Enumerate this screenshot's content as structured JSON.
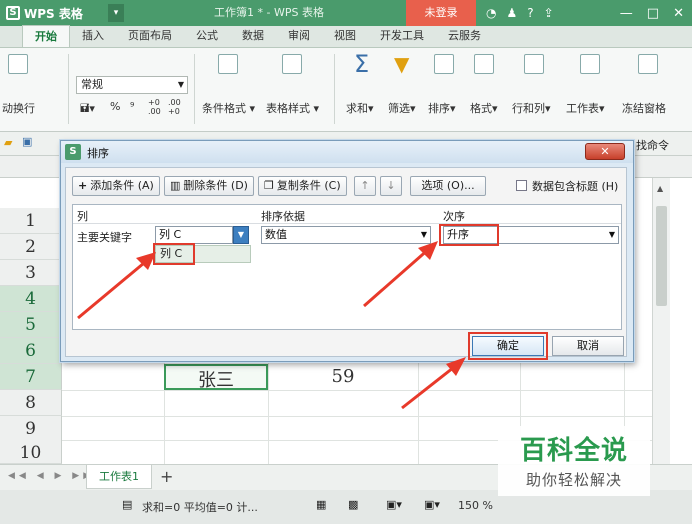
{
  "titlebar": {
    "app_name": "WPS 表格",
    "app_logo_letter": "S",
    "dropdown": "▾",
    "doc_title": "工作簿1 * - WPS 表格",
    "login": "未登录",
    "icons": [
      "skin-icon",
      "shirt-icon",
      "help-icon",
      "upload-icon"
    ],
    "help_label": "?"
  },
  "ribbon": {
    "tabs": [
      "开始",
      "插入",
      "页面布局",
      "公式",
      "数据",
      "审阅",
      "视图",
      "开发工具",
      "云服务"
    ],
    "active_tab": "开始",
    "wrap_label": "动换行",
    "font_name": "常规",
    "percent": "%",
    "comma": "⁹",
    "dec_increase": "+0 .00",
    "dec_decrease": ".00 +0",
    "groups": [
      "条件格式",
      "表格样式",
      "求和",
      "筛选",
      "排序",
      "格式",
      "行和列",
      "工作表",
      "冻结窗格"
    ]
  },
  "quickbar": {
    "find_command": "找命令"
  },
  "sheet": {
    "rows": [
      "1",
      "2",
      "3",
      "4",
      "5",
      "6",
      "7",
      "8",
      "9",
      "10"
    ],
    "highlighted_rows": [
      "4",
      "5",
      "6",
      "7"
    ],
    "cell_name": "张三",
    "cell_score": "59"
  },
  "dialog": {
    "title": "排序",
    "logo": "S",
    "close": "✕",
    "add_condition": "添加条件 (A)",
    "delete_condition": "删除条件 (D)",
    "copy_condition": "复制条件 (C)",
    "move_up": "↑",
    "move_down": "↓",
    "options": "选项 (O)...",
    "has_header": "数据包含标题 (H)",
    "col_header": "列",
    "basis_header": "排序依据",
    "order_header": "次序",
    "primary_key_label": "主要关键字",
    "column_value": "列 C",
    "dropdown_option": "列 C",
    "basis_value": "数值",
    "order_value": "升序",
    "ok": "确定",
    "cancel": "取消"
  },
  "sheet_tabs": {
    "nav": "◀◀ ◀ ▶ ▶▶",
    "tab": "工作表1",
    "add": "+"
  },
  "status": {
    "summary": "求和=0  平均值=0  计...",
    "zoom": "150 %"
  },
  "watermark": {
    "title": "百科全说",
    "subtitle": "助你轻松解决"
  },
  "colors": {
    "titlebar": "#4a9b6c",
    "login": "#e8604c",
    "highlight": "#e03a2c",
    "selection": "#3b9a5a"
  }
}
